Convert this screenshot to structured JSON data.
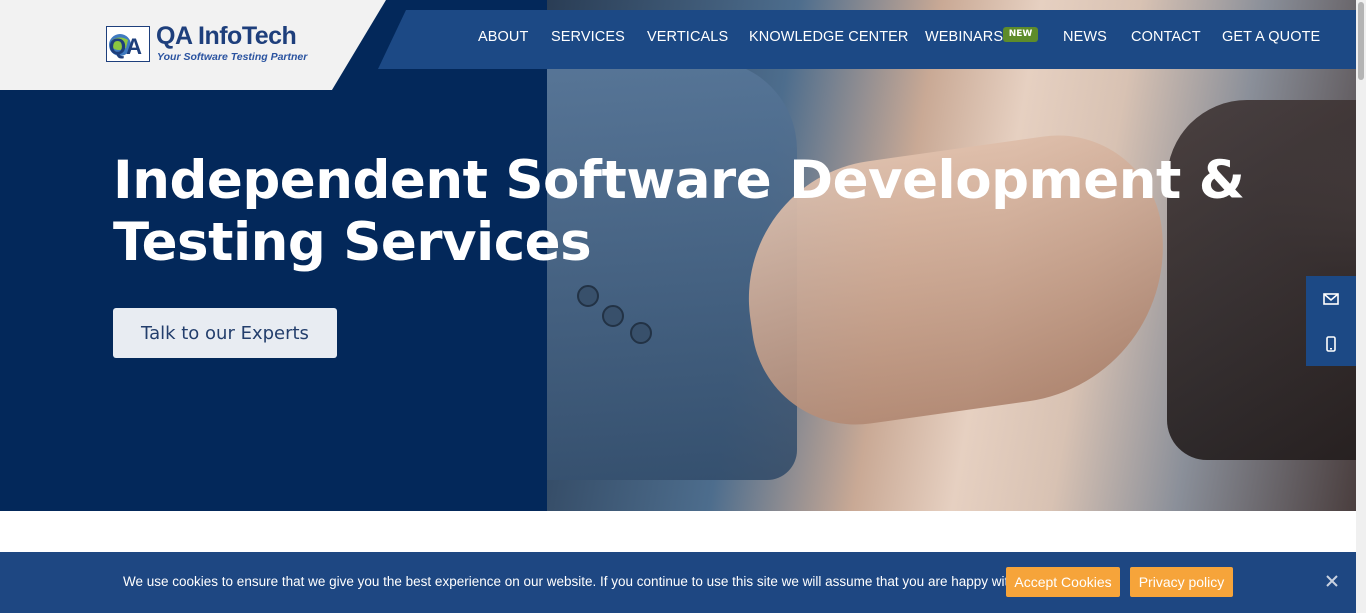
{
  "brand": {
    "name": "QA InfoTech",
    "tagline": "Your Software Testing Partner",
    "logo_mark": "QA"
  },
  "nav": {
    "items": [
      {
        "label": "ABOUT"
      },
      {
        "label": "SERVICES"
      },
      {
        "label": "VERTICALS"
      },
      {
        "label": "KNOWLEDGE CENTER"
      },
      {
        "label": "WEBINARS"
      },
      {
        "label": "NEWS"
      },
      {
        "label": "CONTACT"
      },
      {
        "label": "GET A QUOTE"
      }
    ],
    "new_badge": "NEW"
  },
  "hero": {
    "title_line1": "Independent Software Development &",
    "title_line2": "Testing Services",
    "cta_label": "Talk to our Experts"
  },
  "side_widgets": {
    "icons": [
      "envelope-icon",
      "mobile-phone-icon"
    ]
  },
  "cookie": {
    "message": "We use cookies to ensure that we give you the best experience on our website. If you continue to use this site we will assume that you are happy with it.",
    "accept_label": "Accept Cookies",
    "privacy_label": "Privacy policy"
  },
  "colors": {
    "hero_navy": "#03285a",
    "nav_blue": "#1c4985",
    "cookie_blue": "#1e4782",
    "accent_orange": "#f6a43a",
    "badge_green": "#5e8c2a",
    "logo_blue": "#1e3f7c"
  }
}
